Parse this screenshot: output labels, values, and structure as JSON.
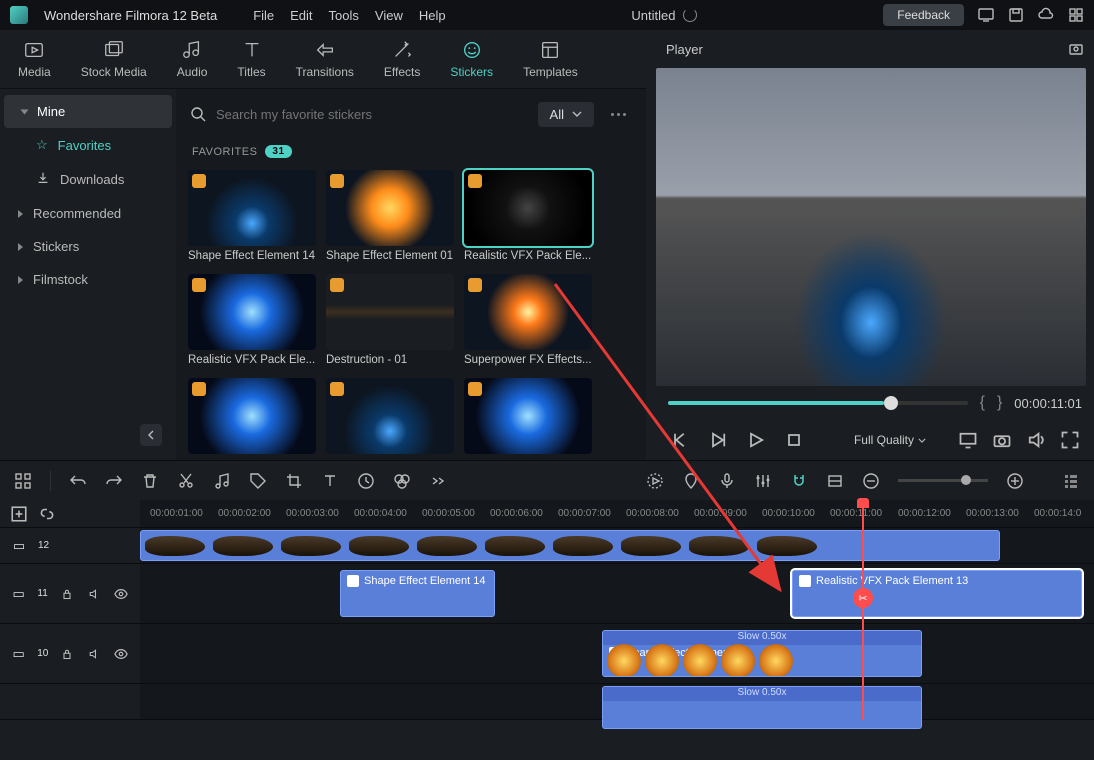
{
  "app": {
    "name": "Wondershare Filmora 12 Beta"
  },
  "menu": {
    "file": "File",
    "edit": "Edit",
    "tools": "Tools",
    "view": "View",
    "help": "Help"
  },
  "doc": {
    "title": "Untitled"
  },
  "feedback": {
    "label": "Feedback"
  },
  "tabs": {
    "media": "Media",
    "stock": "Stock Media",
    "audio": "Audio",
    "titles": "Titles",
    "transitions": "Transitions",
    "effects": "Effects",
    "stickers": "Stickers",
    "templates": "Templates"
  },
  "sidebar": {
    "mine": "Mine",
    "favorites": "Favorites",
    "downloads": "Downloads",
    "recommended": "Recommended",
    "stickers": "Stickers",
    "filmstock": "Filmstock"
  },
  "search": {
    "placeholder": "Search my favorite stickers"
  },
  "filter": {
    "all": "All"
  },
  "favorites": {
    "title": "FAVORITES",
    "count": "31"
  },
  "thumbs": {
    "t0": "Shape Effect Element 14",
    "t1": "Shape Effect Element 01",
    "t2": "Realistic VFX Pack Ele...",
    "t3": "Realistic VFX Pack Ele...",
    "t4": "Destruction - 01",
    "t5": "Superpower FX Effects..."
  },
  "player": {
    "title": "Player",
    "timecode": "00:00:11:01",
    "quality": "Full Quality"
  },
  "ruler": {
    "r1": "00:00:01:00",
    "r2": "00:00:02:00",
    "r3": "00:00:03:00",
    "r4": "00:00:04:00",
    "r5": "00:00:05:00",
    "r6": "00:00:06:00",
    "r7": "00:00:07:00",
    "r8": "00:00:08:00",
    "r9": "00:00:09:00",
    "r10": "00:00:10:00",
    "r11": "00:00:11:00",
    "r12": "00:00:12:00",
    "r13": "00:00:13:00",
    "r14": "00:00:14:0"
  },
  "tracks": {
    "t12": "12",
    "t11": "11",
    "t10": "10"
  },
  "clips": {
    "c1": "Shape Effect Element 14",
    "c2": "Realistic VFX Pack Element 13",
    "c3": "Shape Effect Element 01",
    "slow": "Slow 0.50x"
  }
}
